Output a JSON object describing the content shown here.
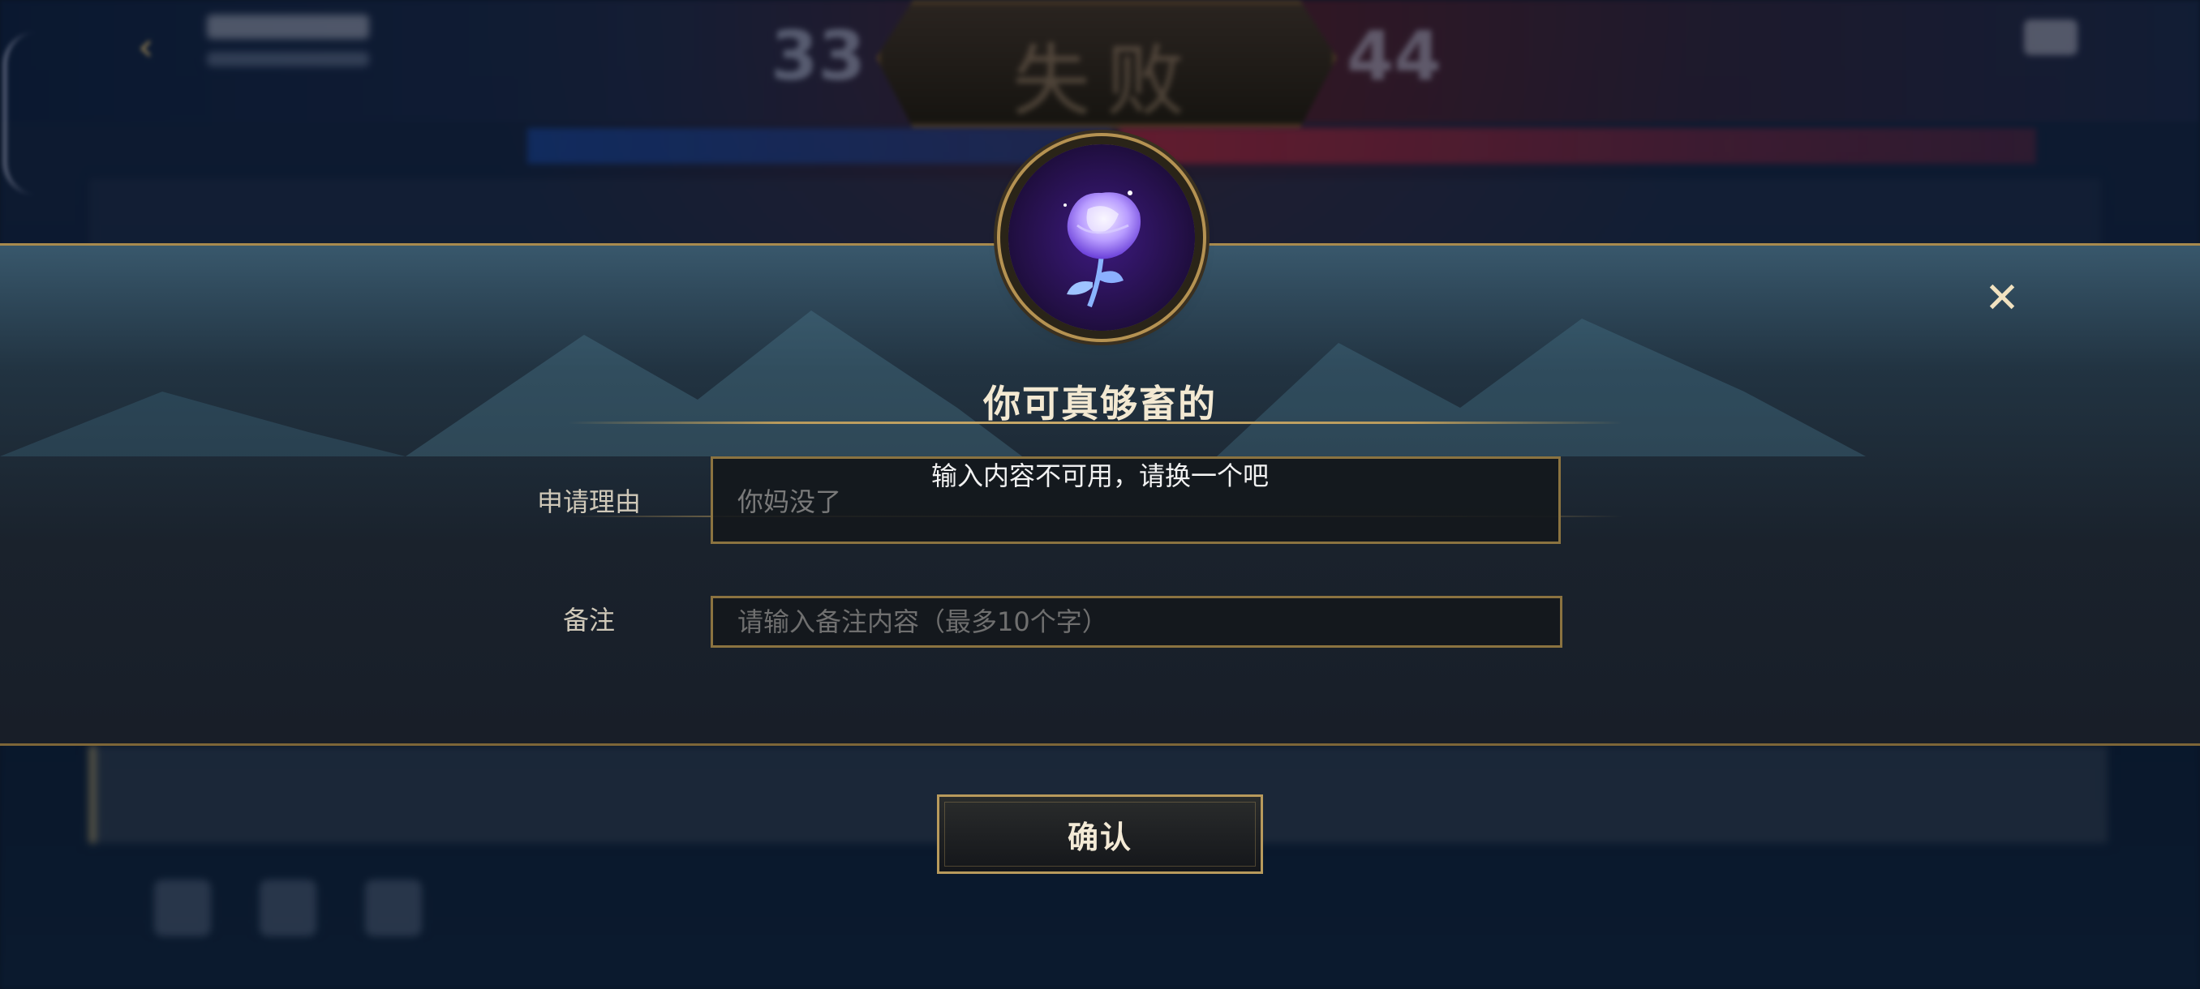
{
  "background": {
    "score_left": "33",
    "result": "失败",
    "score_right": "44"
  },
  "dialog": {
    "title": "你可真够畜的",
    "toast": "输入内容不可用，请换一个吧",
    "reason_label": "申请理由",
    "reason_value": "你妈没了",
    "note_label": "备注",
    "note_placeholder": "请输入备注内容（最多10个字）",
    "close_icon": "close-icon",
    "emblem_icon": "crystal-rose-icon",
    "confirm_label": "确认"
  },
  "colors": {
    "gold_border": "#b89a5c",
    "dialog_bg": "#1e2630",
    "text_primary": "#f3e9d2",
    "emblem_purple": "#3d1a80"
  }
}
